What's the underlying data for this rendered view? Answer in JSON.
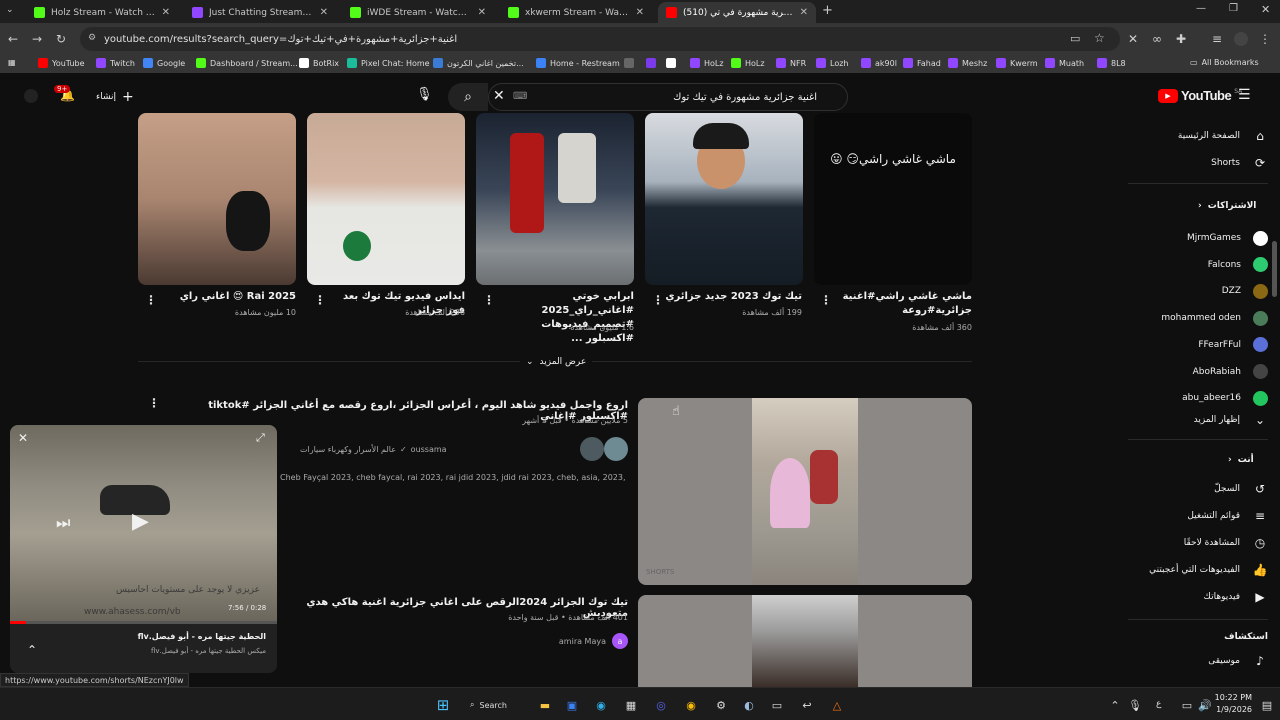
{
  "tabs": [
    {
      "title": "Holz Stream - Watch Live on Ki",
      "favicon": "kick-icon",
      "color": "#53fc18"
    },
    {
      "title": "Just Chatting Streaming - Live S",
      "favicon": "twitch-icon",
      "color": "#9146ff"
    },
    {
      "title": "iWDE Stream - Watch Live on Ki",
      "favicon": "kick-icon",
      "color": "#53fc18"
    },
    {
      "title": "xkwerm Stream - Watch Live on",
      "favicon": "kick-icon",
      "color": "#53fc18"
    },
    {
      "title": "(510) اغنية جزائرية مشهورة في تي",
      "favicon": "youtube-icon",
      "color": "#ff0000"
    }
  ],
  "new_tab_label": "+",
  "address": {
    "url": "youtube.com/results?search_query=اغنية+جزائرية+مشهورة+في+تيك+توك"
  },
  "bookmarks": [
    {
      "label": "YouTube",
      "color": "#ff0000"
    },
    {
      "label": "Twitch",
      "color": "#9146ff"
    },
    {
      "label": "Google",
      "color": "#4285f4"
    },
    {
      "label": "Dashboard / Stream...",
      "color": "#53fc18"
    },
    {
      "label": "BotRix",
      "color": "#ffffff"
    },
    {
      "label": "Pixel Chat: Home",
      "color": "#1abc9c"
    },
    {
      "label": "تخمين اغاني الكرتون...",
      "color": "#3a7bd5"
    },
    {
      "label": "Home - Restream",
      "color": "#3b82f6"
    },
    {
      "label": "",
      "color": "#666"
    },
    {
      "label": "",
      "color": "#7c3aed"
    },
    {
      "label": "",
      "color": "#ffffff"
    },
    {
      "label": "HoLz",
      "color": "#9146ff"
    },
    {
      "label": "HoLz",
      "color": "#53fc18"
    },
    {
      "label": "NFR",
      "color": "#9146ff"
    },
    {
      "label": "Lozh",
      "color": "#9146ff"
    },
    {
      "label": "ak90l",
      "color": "#9146ff"
    },
    {
      "label": "Fahad",
      "color": "#9146ff"
    },
    {
      "label": "Meshz",
      "color": "#9146ff"
    },
    {
      "label": "Kwerm",
      "color": "#9146ff"
    },
    {
      "label": "Muath",
      "color": "#9146ff"
    },
    {
      "label": "8L8",
      "color": "#9146ff"
    }
  ],
  "all_bookmarks": "All Bookmarks",
  "yt": {
    "logo": "YouTube",
    "logo_region": "SA",
    "search_query": "اغنية جزائرية مشهورة في تيك توك",
    "create_label": "إنشاء",
    "notif_count": "9+",
    "shorts": [
      {
        "title": "ماشي غاشي راشي#اغنية جزائرية#روعة",
        "views": "360 ألف مشاهدة",
        "overlay": "ماشي غاشي راشي😏 😛"
      },
      {
        "title": "تيك توك 2023 جديد جزائري",
        "views": "199 ألف مشاهدة"
      },
      {
        "title": "ابرابي خوتي #اغاني_راي_2025 #تصميم_فيديوهات #اكسبلور ...",
        "views": "1.6 مليون مشاهدة"
      },
      {
        "title": "ايداس فيديو تيك توك بعد فوز جزائر",
        "views": "236 ألف مشاهدة"
      },
      {
        "title": "Rai 2025 😍 اغاني راي",
        "views": "10 مليون مشاهدة"
      }
    ],
    "show_more": "عرض المزيد",
    "videos": [
      {
        "title": "اروع واجمل فيديو شاهد اليوم ، أعراس الجزائر ،اروع رقصه مع أغاني الجزائر #tiktok #اكسبلور #اغاني",
        "meta": "5 ملايين مشاهدة • قبل 3 أشهر",
        "channel": "oussama",
        "channel_extra": "عالم الأسرار وكهرباء سيارات",
        "tags": "Cheb Fayçal 2023, cheb faycal, rai 2023, rai jdid 2023, jdid rai 2023, cheb, asia, 2023, Clip Officiel ...",
        "badge": "SHORTS"
      },
      {
        "title": "تيك توك الجزائر 2024الرقص على اغاني جزائرية اغنية هاكي هدي متعوديش",
        "meta": "401 ألف مشاهدة • قبل سنة واحدة",
        "channel": "amira Maya"
      }
    ],
    "sidebar": {
      "home": "الصفحة الرئيسية",
      "shorts": "Shorts",
      "subscriptions_header": "الاشتراكات",
      "subs": [
        {
          "name": "MjrmGames",
          "color": "#ffffff"
        },
        {
          "name": "Falcons",
          "color": "#2ecc71"
        },
        {
          "name": "DZZ",
          "color": "#8b6914"
        },
        {
          "name": "mohammed oden",
          "color": "#4a7c59"
        },
        {
          "name": "FFearFFul",
          "color": "#5b6fd8"
        },
        {
          "name": "AboRabiah",
          "color": "#444"
        },
        {
          "name": "abu_abeer16",
          "color": "#22c55e"
        }
      ],
      "show_more": "إظهار المزيد",
      "you_header": "أنت",
      "you_items": [
        "السجلّ",
        "قوائم التشغيل",
        "المشاهدة لاحقًا",
        "الفيديوهات التي أعجبتني",
        "فيديوهاتك"
      ],
      "explore_header": "استكشاف",
      "explore_items": [
        "موسيقى"
      ]
    },
    "miniplayer": {
      "title": "الحطية جيتها مره - أبو فيصل.flv",
      "subtitle": "ميكس الحطية جيتها مره - أبو فيصل.flv",
      "time": "7:56 / 0:28",
      "watermark": "www.ahasess.com/vb",
      "overlay_text": "عزيزي لا يوجد على مستويات احاسيس"
    }
  },
  "status_url": "https://www.youtube.com/shorts/NEzcnYJ0lw",
  "taskbar": {
    "search_label": "Search",
    "time": "10:22 PM",
    "date": "1/9/2026",
    "lang": "ع"
  }
}
